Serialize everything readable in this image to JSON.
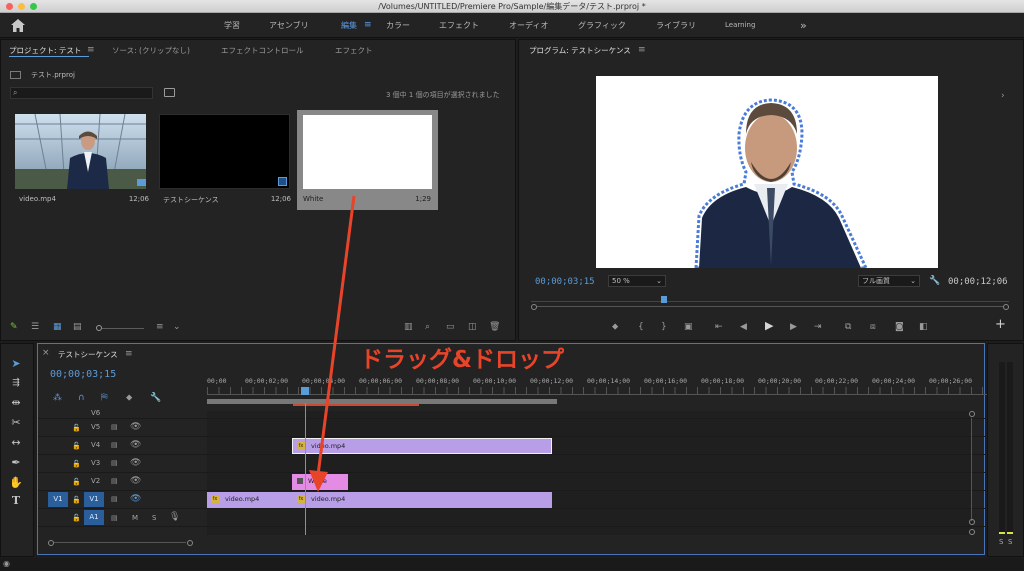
{
  "window": {
    "title": "/Volumes/UNTITLED/Premiere Pro/Sample/編集データ/テスト.prproj *"
  },
  "workspaces": {
    "items": [
      "学習",
      "アセンブリ",
      "編集",
      "カラー",
      "エフェクト",
      "オーディオ",
      "グラフィック",
      "ライブラリ",
      "Learning"
    ],
    "more": "»"
  },
  "project_panel": {
    "tabs": [
      "プロジェクト: テスト",
      "ソース: (クリップなし)",
      "エフェクトコントロール",
      "エフェクト"
    ],
    "file": "テスト.prproj",
    "search_placeholder": "",
    "selection_status": "3 個中 1 個の項目が選択されました",
    "items": [
      {
        "name": "video.mp4",
        "duration": "12;06"
      },
      {
        "name": "テストシーケンス",
        "duration": "12;06"
      },
      {
        "name": "White",
        "duration": "1;29"
      }
    ]
  },
  "program_monitor": {
    "title": "プログラム: テストシーケンス",
    "timecode_current": "00;00;03;15",
    "timecode_total": "00;00;12;06",
    "zoom": "50 %",
    "quality": "フル画質"
  },
  "timeline": {
    "sequence_tab": "テストシーケンス",
    "timecode": "00;00;03;15",
    "ruler_labels": [
      "00;00",
      "00;00;02;00",
      "00;00;04;00",
      "00;00;06;00",
      "00;00;08;00",
      "00;00;10;00",
      "00;00;12;00",
      "00;00;14;00",
      "00;00;16;00",
      "00;00;18;00",
      "00;00;20;00",
      "00;00;22;00",
      "00;00;24;00",
      "00;00;26;00"
    ],
    "tracks": [
      {
        "name": "V6",
        "clips": []
      },
      {
        "name": "V5",
        "clips": []
      },
      {
        "name": "V4",
        "clips": [
          {
            "label": "video.mp4",
            "type": "video",
            "selected": true
          }
        ]
      },
      {
        "name": "V3",
        "clips": []
      },
      {
        "name": "V2",
        "clips": [
          {
            "label": "White",
            "type": "matte"
          }
        ]
      },
      {
        "name": "V1",
        "source": "V1",
        "clips": [
          {
            "label": "video.mp4",
            "type": "video"
          },
          {
            "label": "video.mp4",
            "type": "video"
          }
        ]
      },
      {
        "name": "A1",
        "buttons": [
          "M",
          "S"
        ],
        "clips": []
      }
    ]
  },
  "annotation": {
    "text": "ドラッグ&ドロップ",
    "color": "#e8442a"
  },
  "meter": {
    "labels": [
      "S",
      "S"
    ]
  },
  "colors": {
    "accent": "#5b9bd8",
    "clip_purple": "#b79ee6",
    "clip_pink": "#e48be6",
    "annotation": "#e8442a"
  }
}
